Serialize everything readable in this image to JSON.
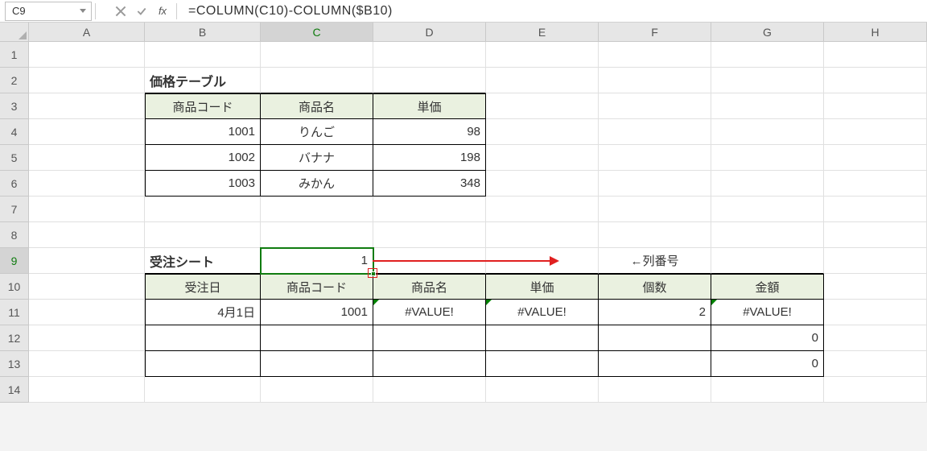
{
  "nameBox": "C9",
  "formula": "=COLUMN(C10)-COLUMN($B10)",
  "columns": [
    "A",
    "B",
    "C",
    "D",
    "E",
    "F",
    "G",
    "H"
  ],
  "rows": [
    "1",
    "2",
    "3",
    "4",
    "5",
    "6",
    "7",
    "8",
    "9",
    "10",
    "11",
    "12",
    "13",
    "14"
  ],
  "activeCol": "C",
  "activeRow": "9",
  "priceTable": {
    "title": "価格テーブル",
    "headers": {
      "code": "商品コード",
      "name": "商品名",
      "price": "単価"
    },
    "rows": [
      {
        "code": "1001",
        "name": "りんご",
        "price": "98"
      },
      {
        "code": "1002",
        "name": "バナナ",
        "price": "198"
      },
      {
        "code": "1003",
        "name": "みかん",
        "price": "348"
      }
    ]
  },
  "orderSheet": {
    "title": "受注シート",
    "colLabel": "←列番号",
    "computed": "1",
    "headers": {
      "date": "受注日",
      "code": "商品コード",
      "name": "商品名",
      "price": "単価",
      "qty": "個数",
      "amount": "金額"
    },
    "rows": [
      {
        "date": "4月1日",
        "code": "1001",
        "name": "#VALUE!",
        "price": "#VALUE!",
        "qty": "2",
        "amount": "#VALUE!"
      },
      {
        "date": "",
        "code": "",
        "name": "",
        "price": "",
        "qty": "",
        "amount": "0"
      },
      {
        "date": "",
        "code": "",
        "name": "",
        "price": "",
        "qty": "",
        "amount": "0"
      }
    ]
  }
}
